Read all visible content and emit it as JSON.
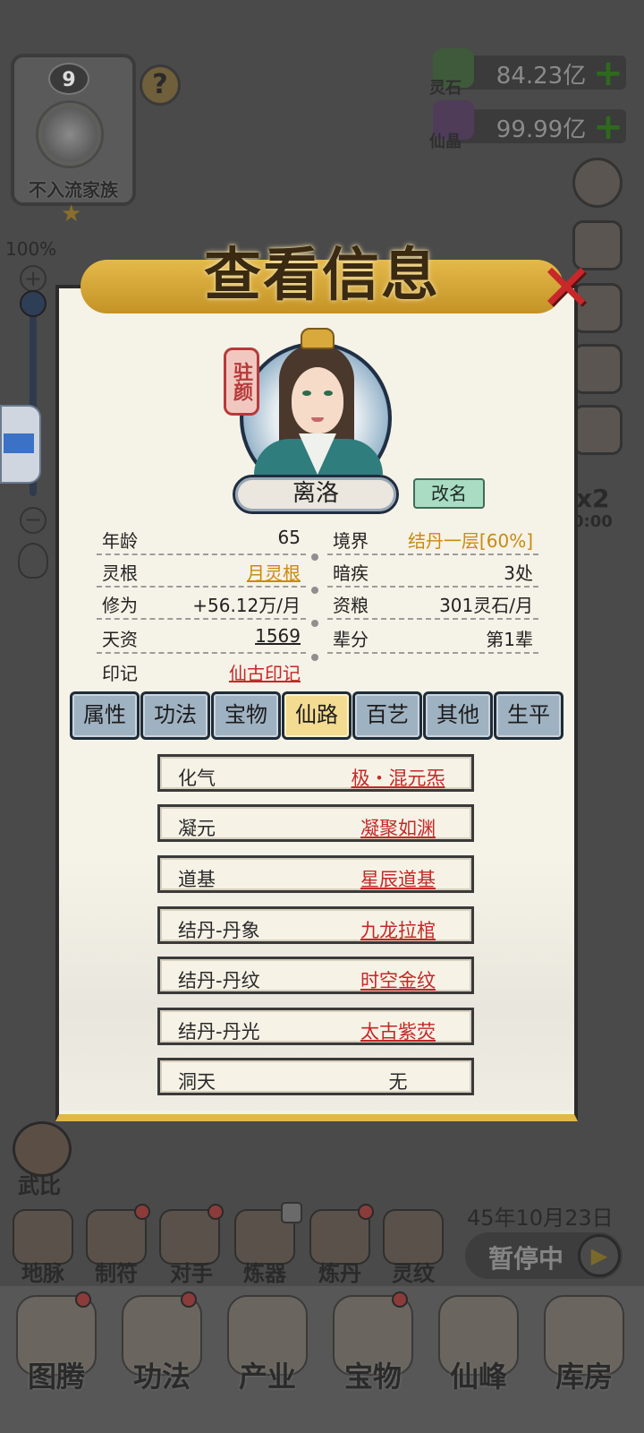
{
  "family": {
    "level": "9",
    "name": "不入流家族",
    "help": "?"
  },
  "currency": [
    {
      "label": "灵石",
      "value": "84.23亿",
      "plus": "+"
    },
    {
      "label": "仙晶",
      "value": "99.99亿",
      "plus": "+"
    }
  ],
  "zoom": {
    "percent": "100%",
    "plus": "+",
    "minus": "−"
  },
  "side": {
    "speed": "x2",
    "timer": "0:00"
  },
  "title": "查看信息",
  "close": "✕",
  "character": {
    "seal": "驻颜",
    "name": "离洛",
    "rename_button": "改名"
  },
  "info": {
    "left": [
      {
        "key": "年龄",
        "value": "65"
      },
      {
        "key": "灵根",
        "value": "月灵根"
      },
      {
        "key": "修为",
        "value": "+56.12万/月"
      },
      {
        "key": "天资",
        "value": "1569"
      },
      {
        "key": "印记",
        "value": "仙古印记"
      }
    ],
    "right": [
      {
        "key": "境界",
        "value": "结丹一层[60%]"
      },
      {
        "key": "暗疾",
        "value": "3处"
      },
      {
        "key": "资粮",
        "value": "301灵石/月"
      },
      {
        "key": "辈分",
        "value": "第1辈"
      }
    ]
  },
  "tabs": [
    "属性",
    "功法",
    "宝物",
    "仙路",
    "百艺",
    "其他",
    "生平"
  ],
  "active_tab": "仙路",
  "path": [
    {
      "key": "化气",
      "value": "极・混元炁"
    },
    {
      "key": "凝元",
      "value": "凝聚如渊"
    },
    {
      "key": "道基",
      "value": "星辰道基"
    },
    {
      "key": "结丹-丹象",
      "value": "九龙拉棺"
    },
    {
      "key": "结丹-丹纹",
      "value": "时空金纹"
    },
    {
      "key": "结丹-丹光",
      "value": "太古紫荧"
    },
    {
      "key": "洞天",
      "value": "无"
    }
  ],
  "wubi": "武比",
  "date": "45年10月23日",
  "pause": "暂停中",
  "play": "▶",
  "actions": [
    "地脉",
    "制符",
    "对手",
    "炼器",
    "炼丹",
    "灵纹"
  ],
  "nav": [
    "图腾",
    "功法",
    "产业",
    "宝物",
    "仙峰",
    "库房"
  ]
}
